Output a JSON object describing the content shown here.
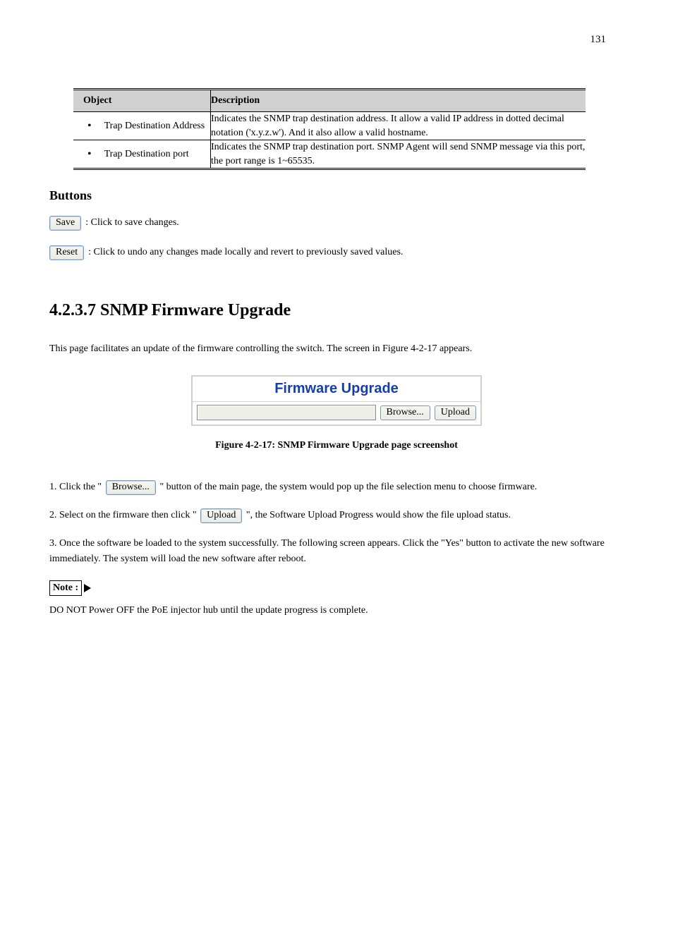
{
  "page_number": "131",
  "table": {
    "headers": {
      "col1": "Object",
      "col2": "Description"
    },
    "rows": [
      {
        "label": "Trap Destination Address",
        "desc": "Indicates the SNMP trap destination address. It allow a valid IP address in dotted decimal notation ('x.y.z.w'). And it also allow a valid hostname."
      },
      {
        "label": "Trap Destination port",
        "desc": "Indicates the SNMP trap destination port. SNMP Agent will send SNMP message via this port, the port range is 1~65535."
      }
    ]
  },
  "buttons_section": {
    "heading": "Buttons",
    "save": {
      "label": "Save",
      "text": ": Click to save changes."
    },
    "reset": {
      "label": "Reset",
      "text": ": Click to undo any changes made locally and revert to previously saved values."
    }
  },
  "section": {
    "number": "4.2.3.7 SNMP Firmware Upgrade",
    "intro": "This page facilitates an update of the firmware controlling the switch. The screen in Figure 4-2-17 appears."
  },
  "firmware_widget": {
    "title": "Firmware Upgrade",
    "browse": "Browse...",
    "upload": "Upload"
  },
  "figure_caption": "Figure 4-2-17: SNMP Firmware Upgrade page screenshot",
  "steps": {
    "s1_a": "1. Click the \"",
    "s1_btn": "Browse...",
    "s1_b": "\" button of the main page, the system would pop up the file selection menu to choose firmware.",
    "s2_a": "2. Select on the firmware then click \"",
    "s2_btn": "Upload",
    "s2_b": "\", the Software Upload Progress would show the file upload status.",
    "s3": "3. Once the software be loaded to the system successfully. The following screen appears. Click the \"Yes\" button to activate the new software immediately. The system will load the new software after reboot."
  },
  "note": {
    "label": "Note :",
    "text": "DO NOT Power OFF the PoE injector hub until the update progress is complete."
  }
}
